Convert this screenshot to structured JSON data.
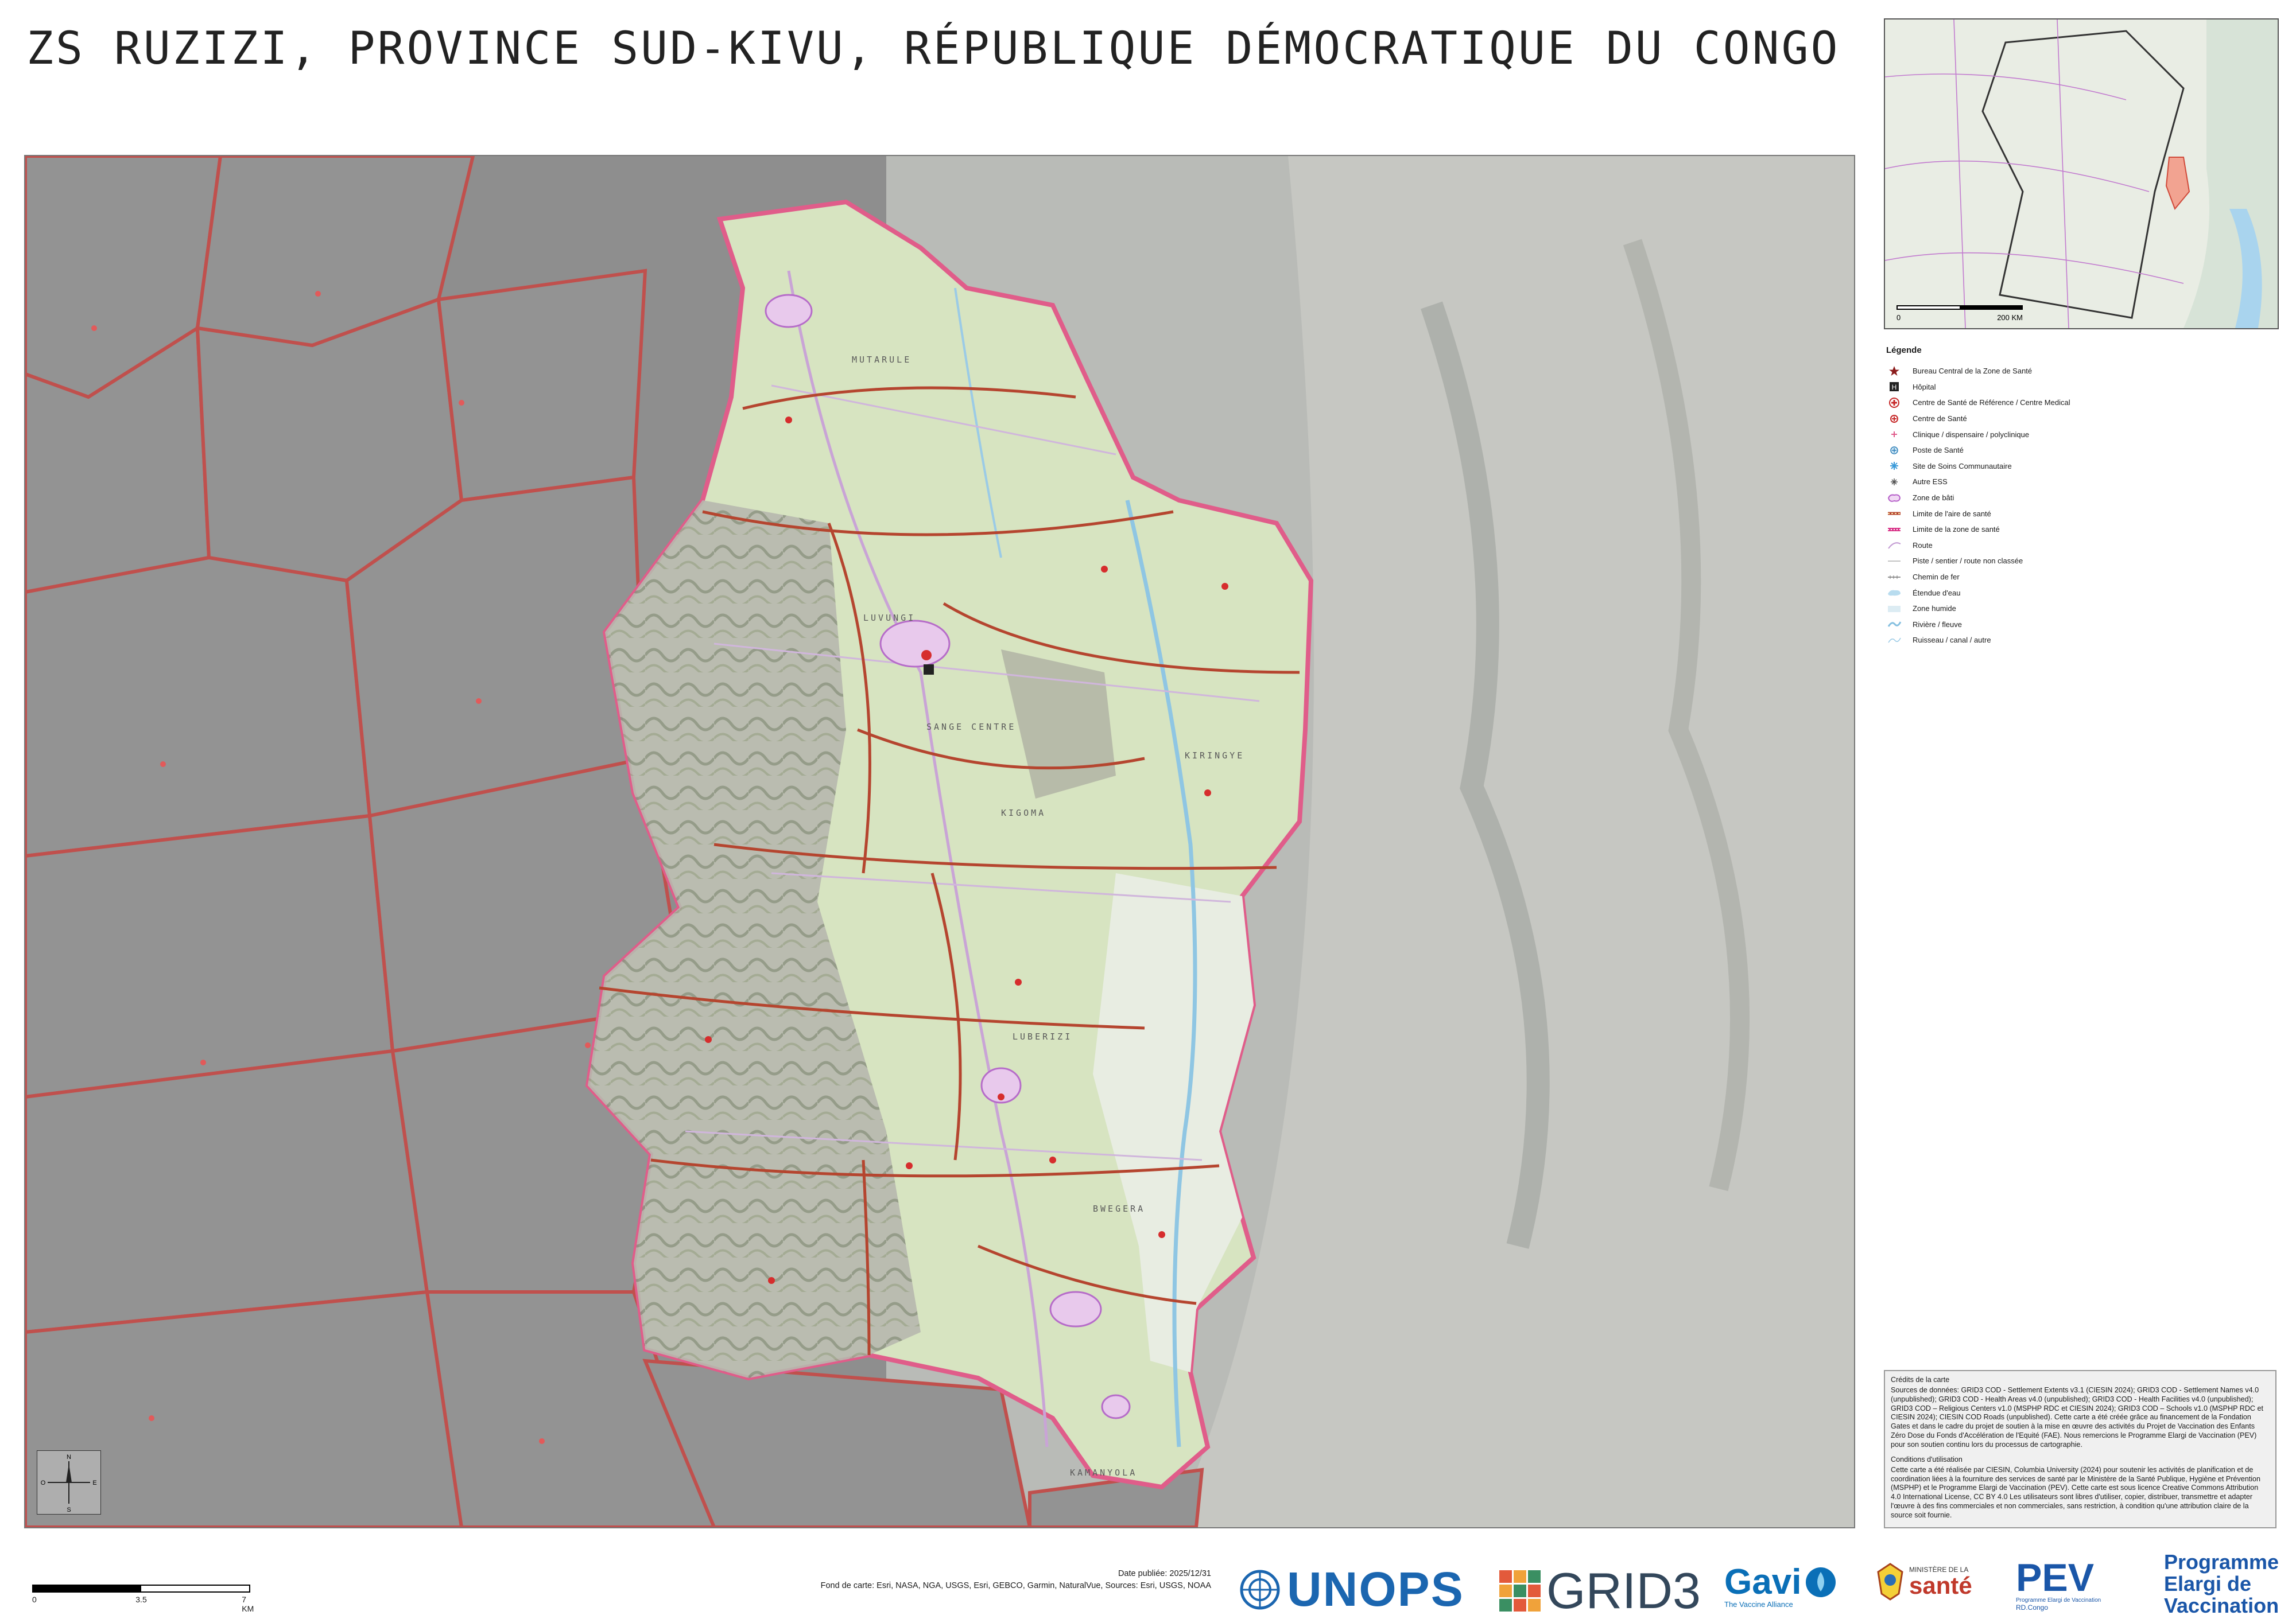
{
  "title": "ZS RUZIZI, PROVINCE SUD-KIVU, RÉPUBLIQUE DÉMOCRATIQUE DU CONGO",
  "inset": {
    "scale_zero": "0",
    "scale_label": "200 KM"
  },
  "legend": {
    "title": "Légende",
    "items": [
      {
        "label": "Bureau Central de la Zone de Santé",
        "icon": "star-icon"
      },
      {
        "label": "Hôpital",
        "icon": "hospital-icon"
      },
      {
        "label": "Centre de Santé de Référence / Centre Medical",
        "icon": "ref-center-icon"
      },
      {
        "label": "Centre de Santé",
        "icon": "health-center-icon"
      },
      {
        "label": "Clinique / dispensaire / polyclinique",
        "icon": "clinic-icon"
      },
      {
        "label": "Poste de Santé",
        "icon": "health-post-icon"
      },
      {
        "label": "Site de Soins Communautaire",
        "icon": "community-site-icon"
      },
      {
        "label": "Autre ESS",
        "icon": "other-ess-icon"
      },
      {
        "label": "Zone de bâti",
        "icon": "built-zone-icon"
      },
      {
        "label": "Limite de l'aire de santé",
        "icon": "health-area-boundary-icon"
      },
      {
        "label": "Limite de la zone de santé",
        "icon": "health-zone-boundary-icon"
      },
      {
        "label": "Route",
        "icon": "road-icon"
      },
      {
        "label": "Piste / sentier / route non classée",
        "icon": "track-icon"
      },
      {
        "label": "Chemin de fer",
        "icon": "railway-icon"
      },
      {
        "label": "Étendue d'eau",
        "icon": "water-body-icon"
      },
      {
        "label": "Zone humide",
        "icon": "wetland-icon"
      },
      {
        "label": "Rivière / fleuve",
        "icon": "river-icon"
      },
      {
        "label": "Ruisseau / canal / autre",
        "icon": "stream-icon"
      }
    ]
  },
  "credits": {
    "heading": "Crédits de la carte",
    "text": "Sources de données: GRID3 COD - Settlement Extents v3.1 (CIESIN 2024); GRID3 COD - Settlement Names v4.0 (unpublished); GRID3 COD - Health Areas v4.0 (unpublished); GRID3 COD - Health Facilities v4.0 (unpublished); GRID3 COD – Religious Centers v1.0 (MSPHP RDC et CIESIN 2024); GRID3 COD – Schools v1.0 (MSPHP RDC et CIESIN 2024); CIESIN COD Roads (unpublished). Cette carte a été créée grâce au financement de la Fondation Gates et dans le cadre du projet de soutien à la mise en œuvre des activités du Projet de Vaccination des Enfants Zéro Dose du Fonds d'Accélération de l'Equité (FAE). Nous remercions le Programme Elargi de Vaccination (PEV) pour son soutien continu lors du processus de cartographie.",
    "conditions_heading": "Conditions d'utilisation",
    "conditions_text": "Cette carte a été réalisée par CIESIN, Columbia University (2024) pour soutenir les activités de planification et de coordination liées à la fourniture des services de santé par le Ministère de la Santé Publique, Hygiène et Prévention (MSPHP) et le Programme Elargi de Vaccination (PEV). Cette carte est sous licence Creative Commons Attribution 4.0 International License, CC BY 4.0 Les utilisateurs sont libres d'utiliser, copier, distribuer, transmettre et adapter l'œuvre à des fins commerciales et non commerciales, sans restriction, à condition qu'une attribution claire de la source soit fournie."
  },
  "scale": {
    "l0": "0",
    "l1": "3.5",
    "l2": "7 KM"
  },
  "publication": {
    "date": "Date publiée: 2025/12/31",
    "basemap": "Fond de carte: Esri, NASA, NGA, USGS, Esri, GEBCO, Garmin, NaturalVue, Sources: Esri, USGS, NOAA"
  },
  "map_labels": {
    "area1": "MUTARULE",
    "area2": "LUVUNGI",
    "area3": "SANGE CENTRE",
    "area4": "KIRINGYE",
    "area5": "KIGOMA",
    "area6": "LUBERIZI",
    "area7": "BWEGERA",
    "area8": "KAMANYOLA",
    "n1": "N",
    "s1": "S",
    "e1": "E",
    "w1": "O"
  },
  "logos": {
    "unops": "UNOPS",
    "grid3": "GRID3",
    "gavi": "Gavi",
    "gavi_sub": "The Vaccine Alliance",
    "ministere_top": "MINISTÈRE DE LA",
    "ministere_main": "santé",
    "pev": "PEV",
    "pev_sub1": "Programme Elargi de Vaccination",
    "pev_sub2": "RD.Congo",
    "prog1": "Programme",
    "prog2": "Elargi de",
    "prog3": "Vaccination"
  },
  "colors": {
    "boundary": "#b5452f",
    "health_zone": "#e05d8a",
    "green": "#cfe0b4",
    "water": "#bfe0f2",
    "pev_blue": "#1a56a8",
    "unops_blue": "#1b66b0",
    "gavi_blue": "#0a6fb7"
  }
}
